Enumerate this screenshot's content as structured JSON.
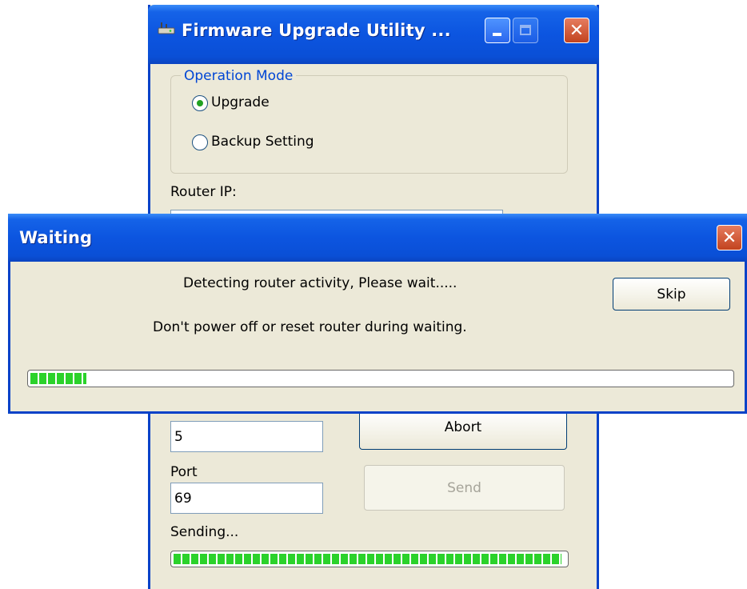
{
  "back_window": {
    "title": "Firmware Upgrade Utility ...",
    "title_icon": "router-icon",
    "caption_buttons": [
      "minimize-icon",
      "maximize-icon",
      "close-icon"
    ],
    "operation_mode": {
      "legend": "Operation Mode",
      "options": [
        {
          "label": "Upgrade",
          "checked": true
        },
        {
          "label": "Backup Setting",
          "checked": false
        }
      ]
    },
    "router_ip_label": "Router IP:",
    "retry_value": "5",
    "abort_label": "Abort",
    "port_label": "Port",
    "port_value": "69",
    "send_label": "Send",
    "status_text": "Sending...",
    "progress_fraction": 0.99
  },
  "waiting_dialog": {
    "title": "Waiting",
    "close_icon": "close-icon",
    "message": "Detecting router activity, Please wait.....",
    "warning": "Don't power off or reset router during waiting.",
    "skip_label": "Skip",
    "progress_fraction": 0.08
  },
  "colors": {
    "titlebar": "#0c55e0",
    "window_face": "#ece9d8",
    "group_legend": "#0046d5",
    "progress_chunk": "#2bd22b",
    "close_button": "#c2431f"
  }
}
